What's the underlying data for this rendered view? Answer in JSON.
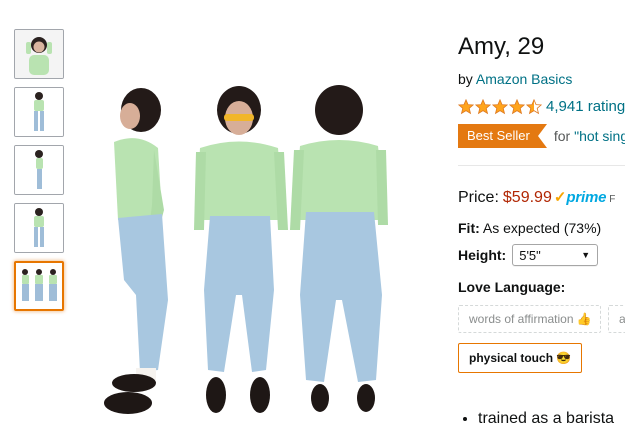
{
  "product": {
    "title": "Amy, 29",
    "by_prefix": "by",
    "brand": "Amazon Basics",
    "rating_count": "4,941 ratings",
    "rating_value": 4.5,
    "badge": "Best Seller",
    "badge_for_prefix": "for",
    "badge_category": "\"hot sing",
    "price_label": "Price:",
    "price": "$59.99",
    "prime_check": "✓",
    "prime_text": "prime",
    "prime_extra": "F",
    "fit_label": "Fit:",
    "fit_value": "As expected (73%)",
    "height_label": "Height:",
    "height_selected": "5'5\"",
    "love_label": "Love Language:",
    "love_options": [
      "words of affirmation 👍",
      "a",
      "physical touch 😎"
    ],
    "bullets": [
      "trained as a barista"
    ]
  },
  "colors": {
    "link": "#007185",
    "price": "#b12704",
    "badge": "#e47911",
    "prime": "#00a8e1",
    "selected_border": "#e77600"
  },
  "icons": {
    "star": "star-icon",
    "caret": "chevron-down-icon"
  }
}
